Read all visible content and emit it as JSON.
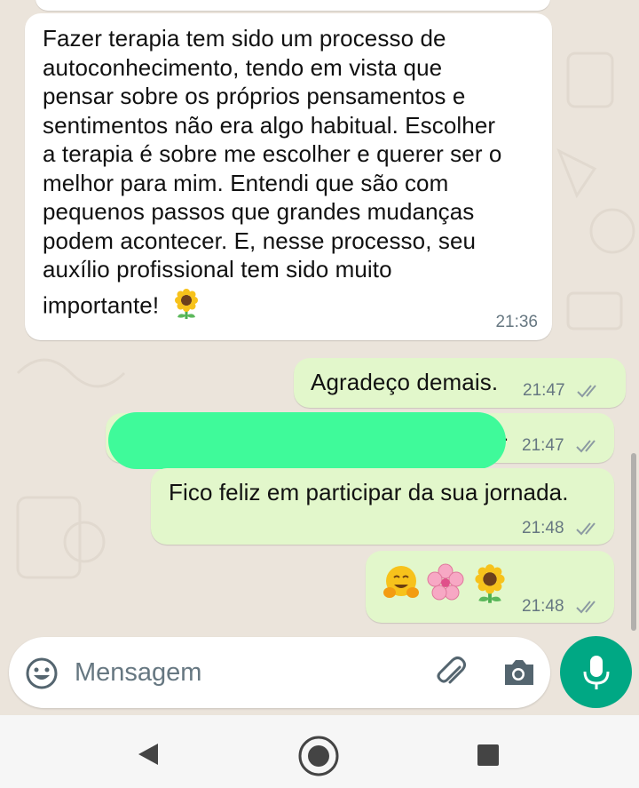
{
  "messages": [
    {
      "direction": "incoming",
      "text": "Fazer terapia tem sido um processo de autoconhecimento, tendo em vista que pensar sobre os próprios pensamentos e sentimentos não era algo habitual. Escolher a terapia é sobre me escolher e querer ser o melhor para mim. Entendi que são com pequenos passos que grandes mudanças podem acontecer. E, nesse processo, seu auxílio profissional tem sido muito importante!",
      "lines": [
        "Fazer terapia tem sido um processo de",
        "autoconhecimento, tendo em vista que",
        "pensar sobre os próprios pensamentos e",
        "sentimentos não era algo habitual. Escolher",
        "a terapia é sobre me escolher e querer ser o",
        "melhor para mim. Entendi que são com",
        "pequenos passos que grandes mudanças",
        "podem acontecer. E, nesse processo, seu",
        "auxílio profissional tem sido muito",
        "importante!"
      ],
      "trailing_emoji": "🌻",
      "time": "21:36"
    },
    {
      "direction": "outgoing",
      "text": "Agradeço demais.",
      "time": "21:47",
      "status": "read"
    },
    {
      "direction": "outgoing",
      "text": ".",
      "time": "21:47",
      "status": "read",
      "redacted": true
    },
    {
      "direction": "outgoing",
      "text": "Fico feliz em participar da sua jornada.",
      "time": "21:48",
      "status": "read"
    },
    {
      "direction": "outgoing",
      "text": "🤗🌸🌻",
      "time": "21:48",
      "status": "read"
    }
  ],
  "composer": {
    "placeholder": "Mensagem",
    "icons": [
      "emoji-icon",
      "attach-icon",
      "camera-icon"
    ],
    "mic_icon": "mic-icon"
  },
  "navbar": {
    "icons": [
      "back-icon",
      "home-icon",
      "recents-icon"
    ]
  },
  "colors": {
    "incoming_bubble": "#ffffff",
    "outgoing_bubble": "#e2f7cb",
    "accent": "#00a884",
    "time_text": "#667781",
    "chat_background": "#ebe4db",
    "redaction": "#3ffa9a"
  }
}
